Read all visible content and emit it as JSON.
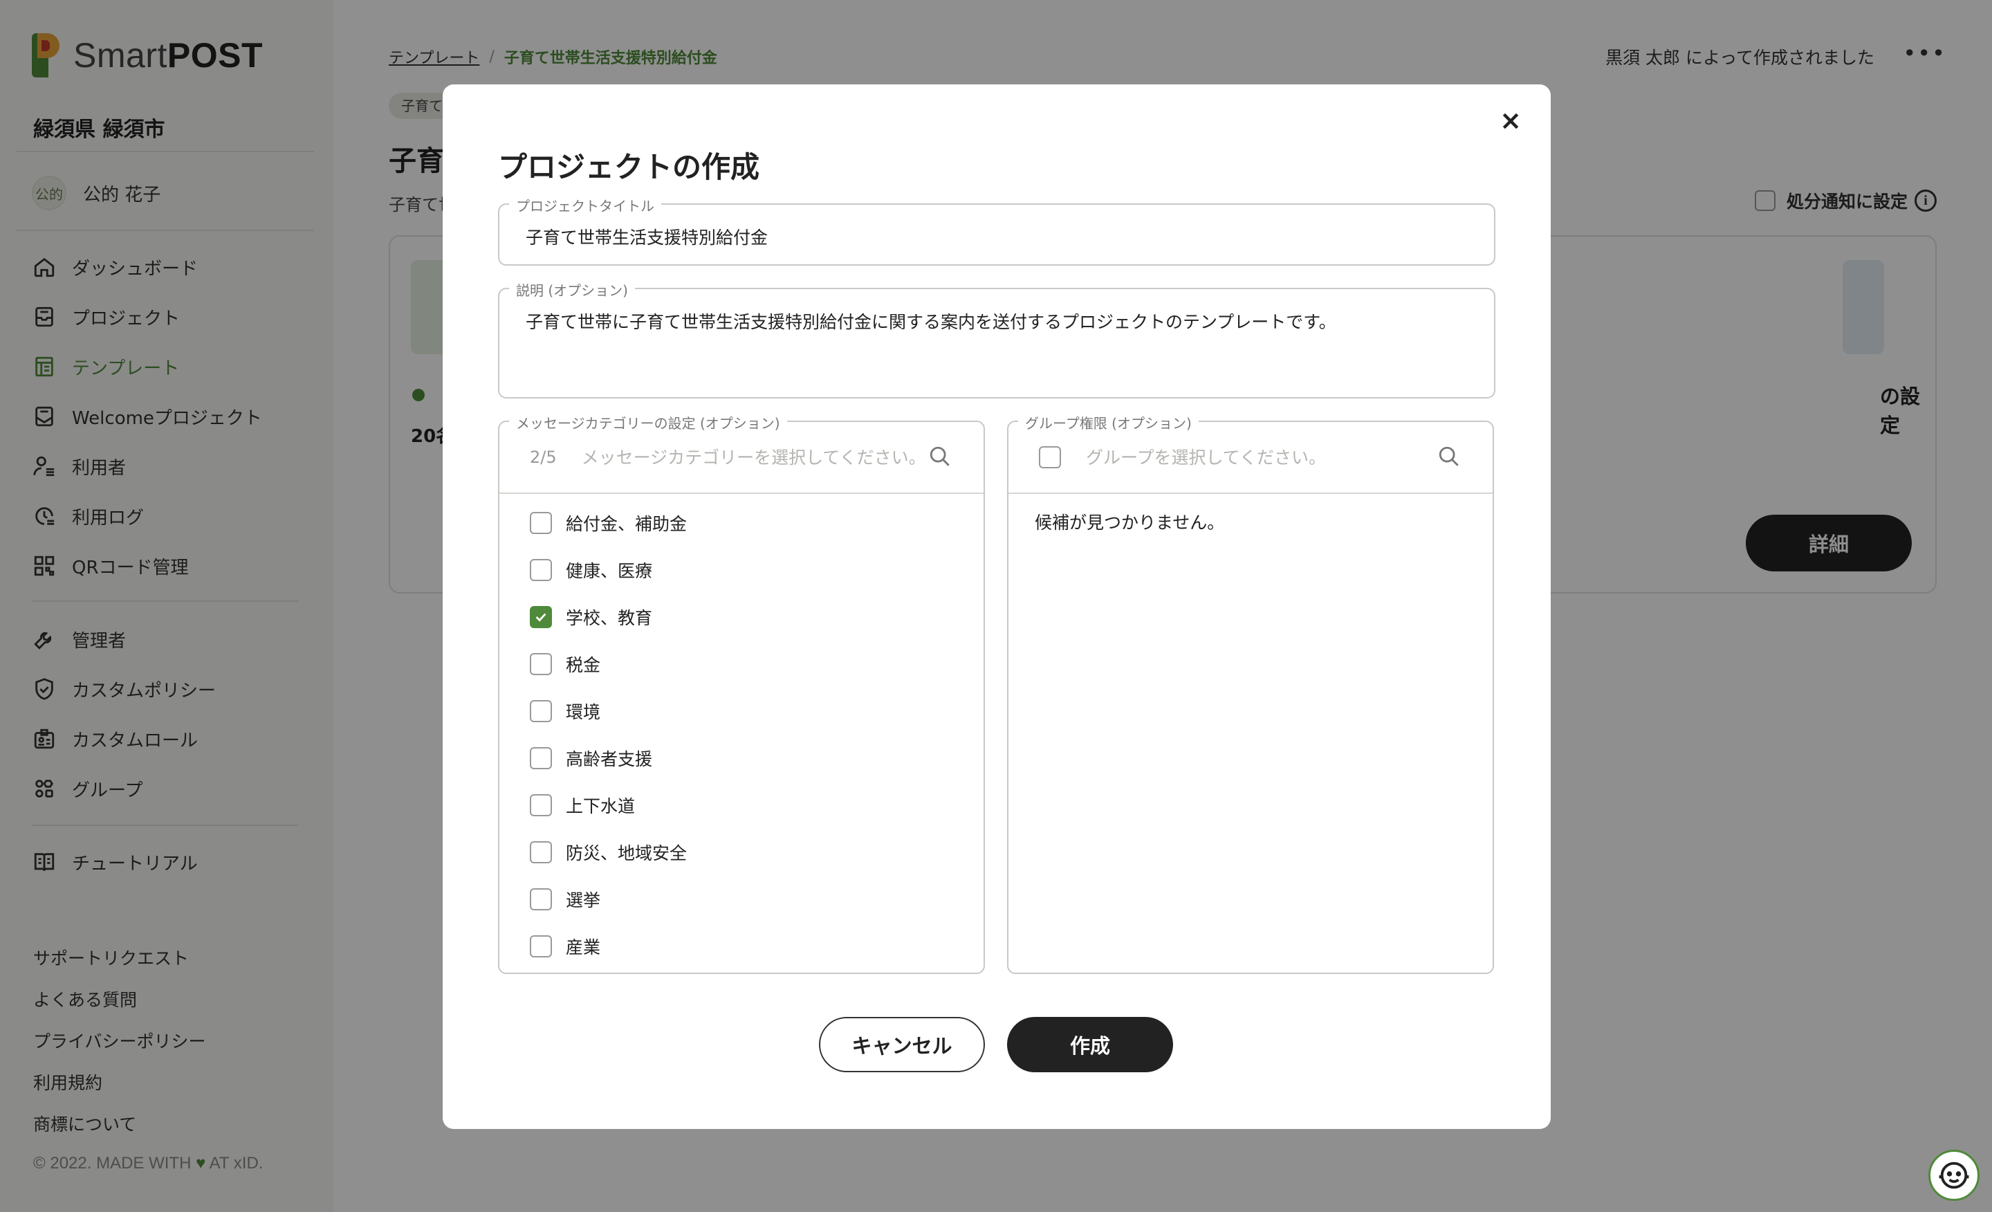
{
  "app": {
    "logo_light": "Smart",
    "logo_bold": "POST"
  },
  "sidebar": {
    "org_name": "緑須県 緑須市",
    "user": {
      "avatar_text": "公的",
      "name": "公的 花子"
    },
    "nav": [
      {
        "label": "ダッシュボード",
        "icon": "home-icon"
      },
      {
        "label": "プロジェクト",
        "icon": "inbox-icon"
      },
      {
        "label": "テンプレート",
        "icon": "template-icon",
        "active": true
      },
      {
        "label": "Welcomeプロジェクト",
        "icon": "mail-icon"
      },
      {
        "label": "利用者",
        "icon": "user-list-icon"
      },
      {
        "label": "利用ログ",
        "icon": "clock-log-icon"
      },
      {
        "label": "QRコード管理",
        "icon": "qr-icon"
      }
    ],
    "admin_nav": [
      {
        "label": "管理者",
        "icon": "wrench-icon"
      },
      {
        "label": "カスタムポリシー",
        "icon": "shield-icon"
      },
      {
        "label": "カスタムロール",
        "icon": "id-card-icon"
      },
      {
        "label": "グループ",
        "icon": "group-icon"
      }
    ],
    "tutorial": {
      "label": "チュートリアル",
      "icon": "book-icon"
    },
    "footer_links": [
      "サポートリクエスト",
      "よくある質問",
      "プライバシーポリシー",
      "利用規約",
      "商標について"
    ],
    "copyright_pre": "© 2022. MADE WITH",
    "copyright_post": "AT xID."
  },
  "main": {
    "breadcrumb": {
      "parent": "テンプレート",
      "separator": "/",
      "current": "子育て世帯生活支援特別給付金"
    },
    "created_by": "黒須 太郎 によって作成されました",
    "more": "•••",
    "tag": "子育て",
    "title": "子育",
    "desc": "子育て世",
    "notice_toggle_label": "処分通知に設定",
    "info_icon": "i",
    "card": {
      "count": "20名",
      "setting_text": "の設定",
      "detail_button": "詳細"
    }
  },
  "modal": {
    "title": "プロジェクトの作成",
    "close": "×",
    "title_field": {
      "label": "プロジェクトタイトル",
      "value": "子育て世帯生活支援特別給付金"
    },
    "desc_field": {
      "label": "説明 (オプション)",
      "value": "子育て世帯に子育て世帯生活支援特別給付金に関する案内を送付するプロジェクトのテンプレートです。"
    },
    "category": {
      "label": "メッセージカテゴリーの設定 (オプション)",
      "counter": "2/5",
      "placeholder": "メッセージカテゴリーを選択してください。",
      "options": [
        {
          "label": "給付金、補助金",
          "checked": false
        },
        {
          "label": "健康、医療",
          "checked": false
        },
        {
          "label": "学校、教育",
          "checked": true
        },
        {
          "label": "税金",
          "checked": false
        },
        {
          "label": "環境",
          "checked": false
        },
        {
          "label": "高齢者支援",
          "checked": false
        },
        {
          "label": "上下水道",
          "checked": false
        },
        {
          "label": "防災、地域安全",
          "checked": false
        },
        {
          "label": "選挙",
          "checked": false
        },
        {
          "label": "産業",
          "checked": false
        }
      ]
    },
    "group": {
      "label": "グループ権限 (オプション)",
      "placeholder": "グループを選択してください。",
      "empty": "候補が見つかりません。"
    },
    "cancel_button": "キャンセル",
    "create_button": "作成"
  },
  "colors": {
    "accent": "#4f8a3a",
    "dark": "#222222",
    "overlay": "rgba(0,0,0,0.44)"
  }
}
